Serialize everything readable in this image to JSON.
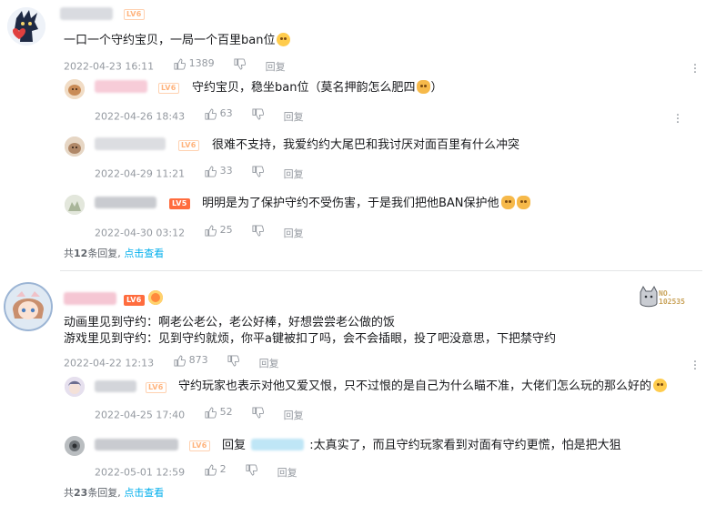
{
  "thread1": {
    "comment": {
      "level": "LV6",
      "text": "一口一个守约宝贝，一局一个百里ban位",
      "emoji": "grinning-emoji",
      "time": "2022-04-23 16:11",
      "likes": "1389",
      "reply_label": "回复"
    },
    "replies": [
      {
        "level": "LV6",
        "text": "守约宝贝，稳坐ban位（莫名押韵怎么肥四",
        "emoji": "cat-emoji",
        "tail": "）",
        "time": "2022-04-26 18:43",
        "likes": "63",
        "reply_label": "回复"
      },
      {
        "level": "LV6",
        "text": "很难不支持，我爱约约大尾巴和我讨厌对面百里有什么冲突",
        "time": "2022-04-29 11:21",
        "likes": "33",
        "reply_label": "回复"
      },
      {
        "level": "LV5",
        "text": "明明是为了保护守约不受伤害，于是我们把他BAN保护他",
        "emoji": "cat-emoji",
        "time": "2022-04-30 03:12",
        "likes": "25",
        "reply_label": "回复"
      }
    ],
    "reply_count": {
      "prefix": "共",
      "count": "12",
      "suffix": "条回复, ",
      "link": "点击查看"
    }
  },
  "thread2": {
    "comment": {
      "level": "LV6",
      "badge_no_label": "NO.",
      "badge_no_value": "102535",
      "text_line1": "动画里见到守约：啊老公老公，老公好棒，好想尝尝老公做的饭",
      "text_line2": "游戏里见到守约：见到守约就烦，你平a键被扣了吗，会不会插眼，投了吧没意思，下把禁守约",
      "time": "2022-04-22 12:13",
      "likes": "873",
      "reply_label": "回复"
    },
    "replies": [
      {
        "level": "LV6",
        "text": "守约玩家也表示对他又爱又恨，只不过恨的是自己为什么瞄不准，大佬们怎么玩的那么好的",
        "emoji": "sweat-emoji",
        "time": "2022-04-25 17:40",
        "likes": "52",
        "reply_label": "回复"
      },
      {
        "level": "LV6",
        "reply_prefix": "回复",
        "text": ":太真实了，而且守约玩家看到对面有守约更慌，怕是把大狙",
        "time": "2022-05-01 12:59",
        "likes": "2",
        "reply_label": "回复"
      }
    ],
    "reply_count": {
      "prefix": "共",
      "count": "23",
      "suffix": "条回复, ",
      "link": "点击查看"
    }
  },
  "colors": {
    "link": "#00aeec",
    "meta": "#9499a0",
    "level_badge": "#ff6c3e",
    "divider": "#e3e5e7"
  }
}
